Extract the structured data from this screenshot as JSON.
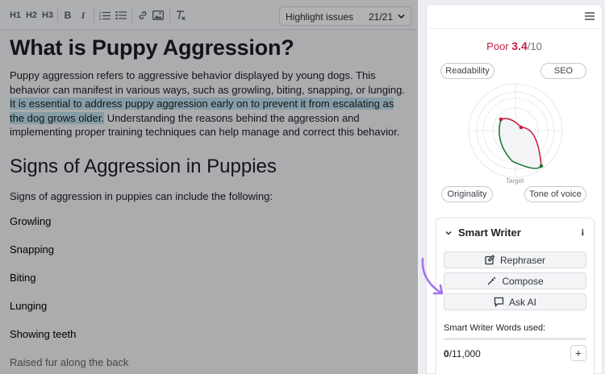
{
  "toolbar": {
    "icons": [
      "heading-1-icon",
      "heading-2-icon",
      "heading-3-icon",
      "bold-icon",
      "italic-icon",
      "ordered-list-icon",
      "bullet-list-icon",
      "link-icon",
      "image-icon",
      "clear-format-icon"
    ],
    "h1_label": "H1",
    "h2_label": "H2",
    "h3_label": "H3",
    "bold_label": "B",
    "italic_label": "I",
    "highlight_select": {
      "label": "Highlight issues",
      "count": "21/21"
    }
  },
  "document": {
    "title": "What is Puppy Aggression?",
    "para1_plain": "Puppy aggression refers to aggressive behavior displayed by young dogs. This behavior can manifest in various ways, such as growling, biting, snapping, or lunging. ",
    "para1_highlight": "It is essential to address puppy aggression early on to prevent it from escalating as the dog grows older.",
    "para1_tail": " Understanding the reasons behind the aggression and implementing proper training techniques can help manage and correct this behavior.",
    "section_title": "Signs of Aggression in Puppies",
    "intro": "Signs of aggression in puppies can include the following:",
    "list": [
      "Growling",
      "Snapping",
      "Biting",
      "Lunging",
      "Showing teeth",
      "Raised fur along the back"
    ]
  },
  "panel": {
    "score": {
      "rating": "Poor",
      "value": "3.4",
      "max": "/10"
    },
    "radar_labels": {
      "readability": "Readability",
      "seo": "SEO",
      "originality": "Originality",
      "tone": "Tone of voice",
      "target": "Target"
    },
    "smart_writer": {
      "title": "Smart Writer",
      "info": "i",
      "buttons": [
        "Rephraser",
        "Compose",
        "Ask AI"
      ],
      "words_label": "Smart Writer Words used:",
      "words_used": "0",
      "words_total": "/11,000",
      "words_fraction": 0,
      "plus": "+"
    }
  },
  "colors": {
    "score_red": "#c11f45",
    "highlight": "#bfe1ee",
    "arrow": "#a472f0",
    "radar_green": "#1e7a3c",
    "radar_red": "#c8203f"
  }
}
